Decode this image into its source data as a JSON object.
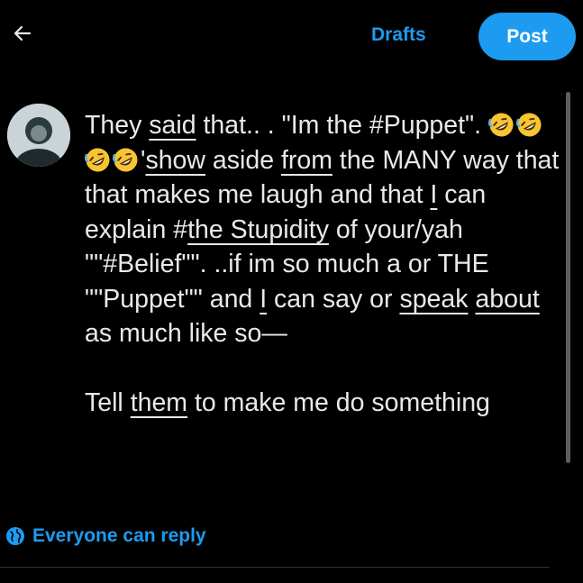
{
  "header": {
    "back_icon": "arrow-left-icon",
    "drafts_label": "Drafts",
    "post_label": "Post"
  },
  "colors": {
    "accent": "#1d9bf0",
    "background": "#000000",
    "text": "#e7e9ea"
  },
  "composer": {
    "avatar": "user-avatar",
    "segments": [
      "They ",
      "said",
      " that.. . \"Im the #Puppet\".",
      "'",
      "show",
      " aside ",
      "from",
      " the MANY way that that makes me laugh and that ",
      "I",
      " can explain #",
      "the Stupidity",
      " of your/yah \"\"#Belief\"\". ..if im so much a or THE \"\"Puppet\"\" and ",
      "I",
      " can say or ",
      "speak",
      " ",
      "about",
      " as much like so—",
      "Tell ",
      "them",
      " to make me do something"
    ],
    "emoji_icon": "rolling-on-floor-laughing-emoji",
    "emoji_count": 4
  },
  "footer": {
    "reply_icon": "globe-icon",
    "reply_label": "Everyone can reply"
  }
}
